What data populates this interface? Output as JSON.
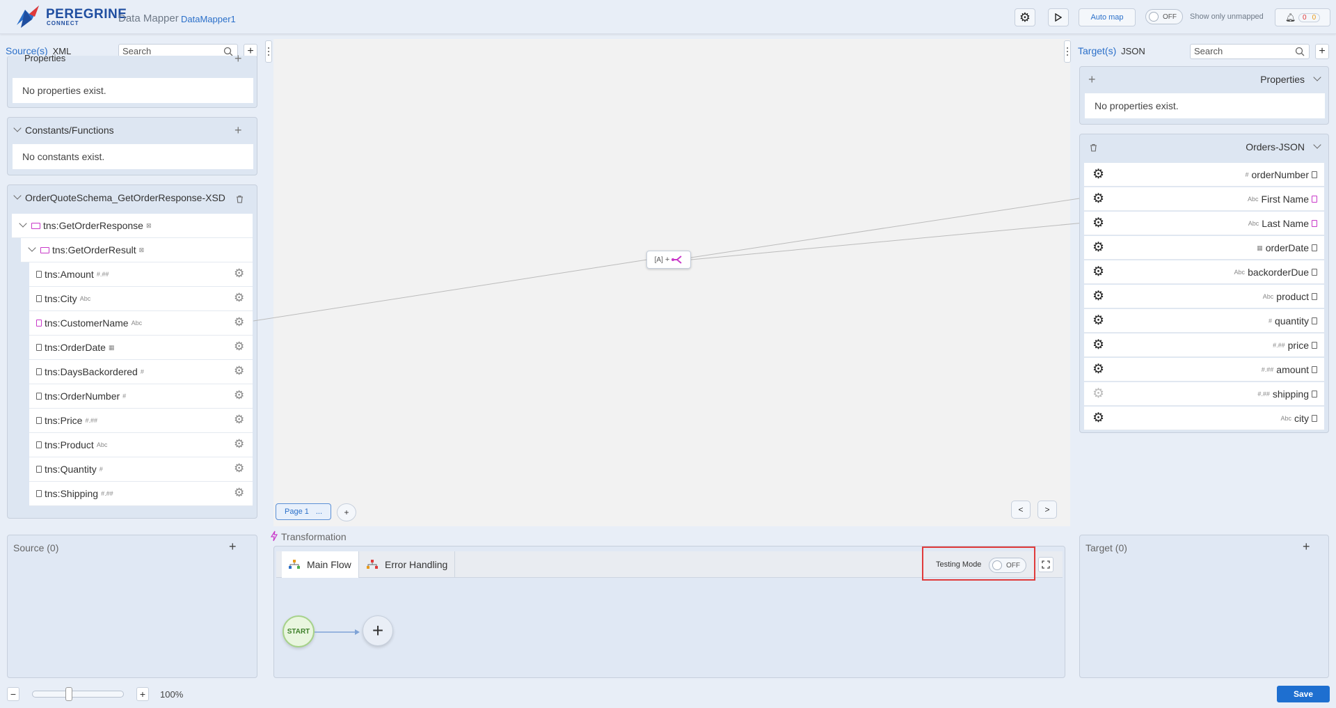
{
  "header": {
    "brand": "PEREGRINE",
    "brand_sub": "CONNECT",
    "app_name": "Data Mapper",
    "doc_name": "DataMapper1",
    "auto_map_label": "Auto map",
    "unmapped_toggle_state": "OFF",
    "show_only_unmapped_label": "Show only unmapped",
    "error_count": "0",
    "warning_count": "0"
  },
  "source": {
    "title_prefix": "Source(s)",
    "title_type": "XML",
    "search_placeholder": "Search",
    "properties_partial_label": "Properties",
    "no_properties_text": "No properties exist.",
    "constants_title": "Constants/Functions",
    "no_constants_text": "No constants exist.",
    "schema_title": "OrderQuoteSchema_GetOrderResponse-XSD",
    "root": "tns:GetOrderResponse",
    "root_child": "tns:GetOrderResult",
    "fields": [
      {
        "name": "tns:Amount",
        "type": "#.##"
      },
      {
        "name": "tns:City",
        "type": "Abc"
      },
      {
        "name": "tns:CustomerName",
        "type": "Abc"
      },
      {
        "name": "tns:OrderDate",
        "type": "▦"
      },
      {
        "name": "tns:DaysBackordered",
        "type": "#"
      },
      {
        "name": "tns:OrderNumber",
        "type": "#"
      },
      {
        "name": "tns:Price",
        "type": "#.##"
      },
      {
        "name": "tns:Product",
        "type": "Abc"
      },
      {
        "name": "tns:Quantity",
        "type": "#"
      },
      {
        "name": "tns:Shipping",
        "type": "#.##"
      }
    ]
  },
  "target": {
    "title_prefix": "Target(s)",
    "title_type": "JSON",
    "search_placeholder": "Search",
    "properties_title": "Properties",
    "no_properties_text": "No properties exist.",
    "schema_title": "Orders-JSON",
    "fields": [
      {
        "name": "orderNumber",
        "type": "#"
      },
      {
        "name": "First Name",
        "type": "Abc"
      },
      {
        "name": "Last Name",
        "type": "Abc"
      },
      {
        "name": "orderDate",
        "type": "▦"
      },
      {
        "name": "backorderDue",
        "type": "Abc"
      },
      {
        "name": "product",
        "type": "Abc"
      },
      {
        "name": "quantity",
        "type": "#"
      },
      {
        "name": "price",
        "type": "#.##"
      },
      {
        "name": "amount",
        "type": "#.##"
      },
      {
        "name": "shipping",
        "type": "#.##"
      },
      {
        "name": "city",
        "type": "Abc"
      }
    ]
  },
  "canvas": {
    "page_tab": "Page 1",
    "page_tab_menu": "...",
    "add_page": "+",
    "prev": "<",
    "next": ">",
    "fn_node_label": "[A] +"
  },
  "bottom": {
    "source_title": "Source (0)",
    "target_title": "Target (0)",
    "transformation_title": "Transformation",
    "tab_main_flow": "Main Flow",
    "tab_error_handling": "Error Handling",
    "testing_mode_label": "Testing Mode",
    "testing_mode_state": "OFF",
    "start_label": "START",
    "zoom_level": "100%",
    "save_label": "Save"
  }
}
